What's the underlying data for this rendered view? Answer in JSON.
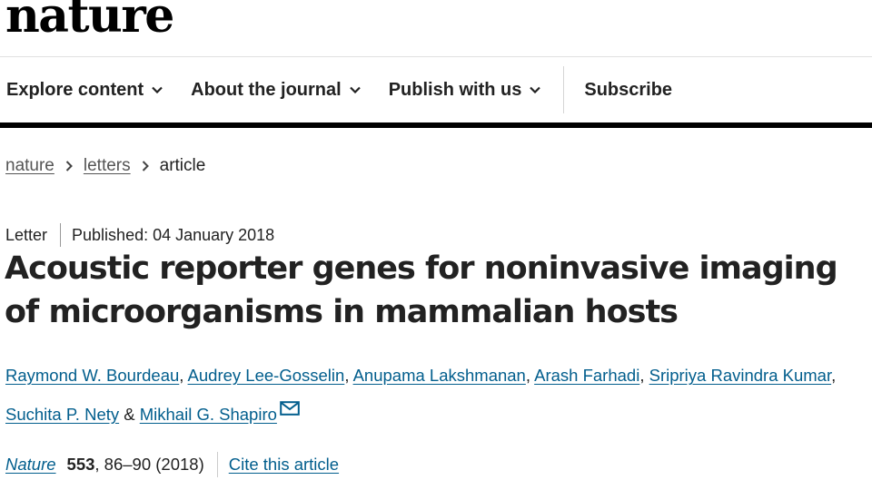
{
  "header": {
    "logo": "nature"
  },
  "nav": {
    "items": [
      {
        "label": "Explore content",
        "icon": "chevron-down-icon"
      },
      {
        "label": "About the journal",
        "icon": "chevron-down-icon"
      },
      {
        "label": "Publish with us",
        "icon": "chevron-down-icon"
      },
      {
        "label": "Subscribe"
      }
    ]
  },
  "breadcrumb": {
    "items": [
      "nature",
      "letters"
    ],
    "current": "article",
    "separator_icon": "chevron-right-icon"
  },
  "article": {
    "type": "Letter",
    "published": "Published: 04 January 2018",
    "title": "Acoustic reporter genes for noninvasive imaging of microorganisms in mammalian hosts",
    "authors": [
      "Raymond W. Bourdeau",
      "Audrey Lee-Gosselin",
      "Anupama Lakshmanan",
      "Arash Farhadi",
      "Sripriya Ravindra Kumar",
      "Suchita P. Nety",
      "Mikhail G. Shapiro"
    ],
    "author_sep": ",",
    "author_and": "&",
    "corresponding_icon": "mail-icon",
    "citation": {
      "journal": "Nature",
      "volume": "553",
      "pages_year": ", 86–90 (2018)",
      "cite_label": "Cite this article"
    }
  },
  "colors": {
    "link": "#025e8d",
    "text": "#222222",
    "nav_bar": "#000000"
  }
}
